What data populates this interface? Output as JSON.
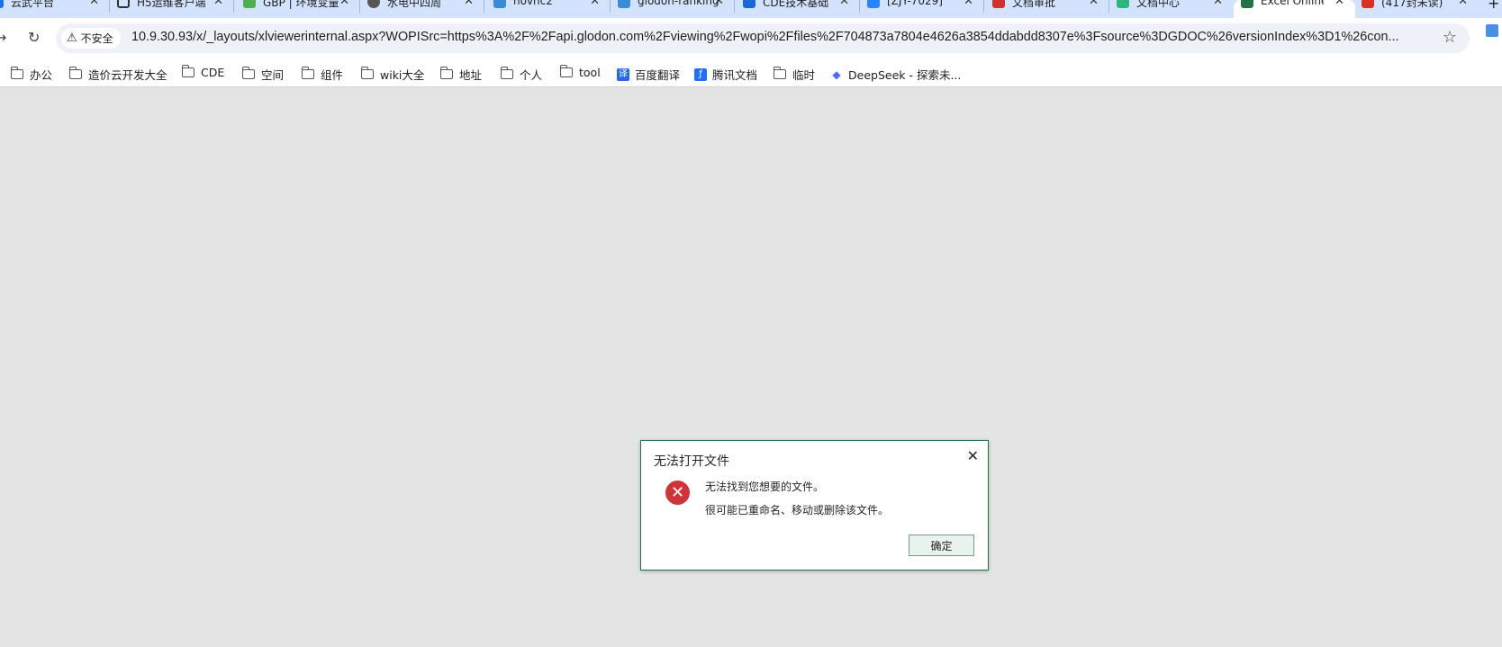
{
  "tabs": [
    {
      "title": "云武平台",
      "icon": "cloud-app-icon",
      "color": "#1a73e8"
    },
    {
      "title": "H5运维客户端",
      "icon": "shield-icon",
      "color": "#333333"
    },
    {
      "title": "GBP | 环境变量",
      "icon": "gbp-app-icon",
      "color": "#4caf50"
    },
    {
      "title": "水电中四周",
      "icon": "globe-icon",
      "color": "#555555"
    },
    {
      "title": "novnc2",
      "icon": "puzzle-icon",
      "color": "#3a8bd6"
    },
    {
      "title": "glodon-ranking",
      "icon": "puzzle-icon",
      "color": "#3a8bd6"
    },
    {
      "title": "CDE技术基础",
      "icon": "confluence-icon",
      "color": "#1868db"
    },
    {
      "title": "[ZJY-7029]",
      "icon": "jira-icon",
      "color": "#2684ff"
    },
    {
      "title": "文档审批",
      "icon": "doc-approval-icon",
      "color": "#d0312d"
    },
    {
      "title": "文档中心",
      "icon": "doc-center-icon",
      "color": "#2eb67d"
    },
    {
      "title": "Excel Online",
      "icon": "excel-icon",
      "color": "#217346",
      "active": true
    },
    {
      "title": "(417封未读)",
      "icon": "mail-icon",
      "color": "#d93025"
    }
  ],
  "tab_close_glyph": "✕",
  "new_tab_glyph": "+",
  "nav": {
    "back_glyph": "→",
    "reload_glyph": "↻"
  },
  "omnibox": {
    "security_label": "不安全",
    "url": "10.9.30.93/x/_layouts/xlviewerinternal.aspx?WOPISrc=https%3A%2F%2Fapi.glodon.com%2Fviewing%2Fwopi%2Ffiles%2F704873a7804e4626a3854ddabdd8307e%3Fsource%3DGDOC%26versionIndex%3D1%26con...",
    "bookmark_glyph": "☆"
  },
  "bookmarks": [
    {
      "label": "办公",
      "type": "folder"
    },
    {
      "label": "造价云开发大全",
      "type": "folder"
    },
    {
      "label": "CDE",
      "type": "folder"
    },
    {
      "label": "空间",
      "type": "folder"
    },
    {
      "label": "组件",
      "type": "folder"
    },
    {
      "label": "wiki大全",
      "type": "folder"
    },
    {
      "label": "地址",
      "type": "folder"
    },
    {
      "label": "个人",
      "type": "folder"
    },
    {
      "label": "tool",
      "type": "folder"
    },
    {
      "label": "百度翻译",
      "type": "link",
      "icon": "translate-icon",
      "color": "#2468f2",
      "glyph": "译"
    },
    {
      "label": "腾讯文档",
      "type": "link",
      "icon": "tencent-docs-icon",
      "color": "#1e6fff",
      "glyph": "ƒ"
    },
    {
      "label": "临时",
      "type": "folder"
    },
    {
      "label": "DeepSeek - 探索未...",
      "type": "link",
      "icon": "deepseek-icon",
      "color": "#4d6bfe",
      "glyph": "◆"
    }
  ],
  "dialog": {
    "title": "无法打开文件",
    "close_glyph": "✕",
    "error_glyph": "✕",
    "message_line1": "无法找到您想要的文件。",
    "message_line2": "很可能已重命名、移动或删除该文件。",
    "ok_label": "确定",
    "accent_color": "#217346",
    "error_color": "#d13438"
  }
}
